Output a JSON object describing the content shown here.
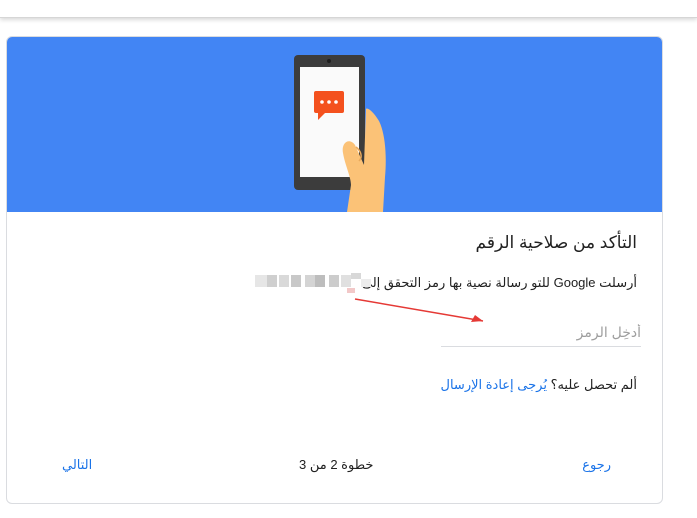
{
  "card": {
    "title": "التأكد من صلاحية الرقم",
    "subtitle": "أرسلت Google للتو رسالة نصية بها رمز التحقق إلى",
    "code_placeholder": "أدخِل الرمز",
    "resend_prompt": "ألم تحصل عليه؟",
    "resend_link": "يُرجى إعادة الإرسال"
  },
  "footer": {
    "back_label": "رجوع",
    "step_label": "خطوة 2 من 3",
    "next_label": "التالي"
  },
  "colors": {
    "hero_blue": "#4285f4",
    "link_blue": "#1a73e8",
    "bubble_orange": "#f4511e",
    "hand_skin": "#fbc277",
    "annotation_red": "#e53935"
  },
  "icons": {
    "hero": "phone-with-message-icon",
    "annotation": "red-arrow"
  }
}
